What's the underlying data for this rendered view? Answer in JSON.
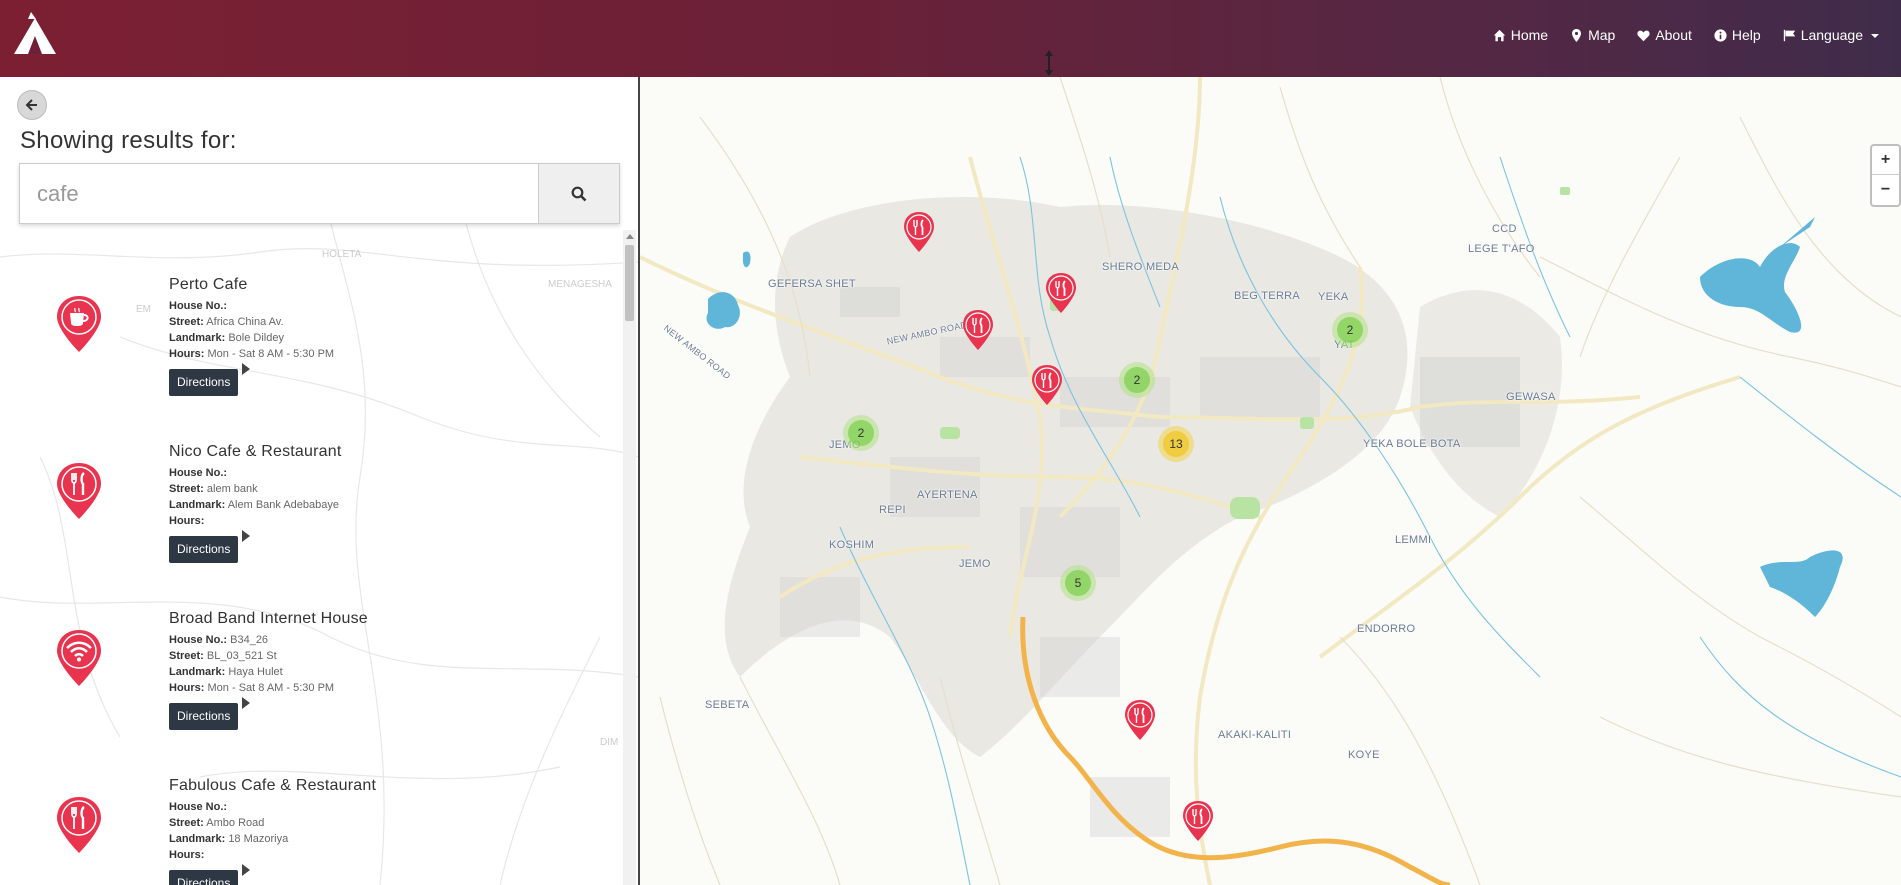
{
  "header": {
    "nav": [
      {
        "label": "Home",
        "icon": "home-icon"
      },
      {
        "label": "Map",
        "icon": "map-marker-icon"
      },
      {
        "label": "About",
        "icon": "heart-icon"
      },
      {
        "label": "Help",
        "icon": "info-circle-icon"
      },
      {
        "label": "Language",
        "icon": "flag-icon"
      }
    ]
  },
  "panel": {
    "title": "Showing results for:",
    "search": {
      "value": "cafe"
    },
    "results": [
      {
        "name": "Perto Cafe",
        "house_label": "House No.:",
        "house": "",
        "street_label": "Street:",
        "street": "Africa China Av.",
        "landmark_label": "Landmark:",
        "landmark": "Bole Dildey",
        "hours_label": "Hours:",
        "hours": "Mon - Sat 8 AM - 5:30 PM",
        "directions": "Directions",
        "icon": "coffee-cup-icon"
      },
      {
        "name": "Nico Cafe & Restaurant",
        "house_label": "House No.:",
        "house": "",
        "street_label": "Street:",
        "street": "alem bank",
        "landmark_label": "Landmark:",
        "landmark": "Alem Bank Adebabaye",
        "hours_label": "Hours:",
        "hours": "",
        "directions": "Directions",
        "icon": "fork-knife-icon"
      },
      {
        "name": "Broad Band Internet House",
        "house_label": "House No.:",
        "house": "B34_26",
        "street_label": "Street:",
        "street": "BL_03_521 St",
        "landmark_label": "Landmark:",
        "landmark": "Haya Hulet",
        "hours_label": "Hours:",
        "hours": "Mon - Sat 8 AM - 5:30 PM",
        "directions": "Directions",
        "icon": "wifi-icon"
      },
      {
        "name": "Fabulous Cafe & Restaurant",
        "house_label": "House No.:",
        "house": "",
        "street_label": "Street:",
        "street": "Ambo Road",
        "landmark_label": "Landmark:",
        "landmark": "18 Mazoriya",
        "hours_label": "Hours:",
        "hours": "",
        "directions": "Directions",
        "icon": "fork-knife-icon"
      }
    ],
    "bg_labels": [
      "HOLETA",
      "MENAGESHA",
      "EM",
      "DIM"
    ]
  },
  "map": {
    "zoom_in": "+",
    "zoom_out": "−",
    "labels": [
      "GEFERSA SHET",
      "NEW AMBO ROAD",
      "SHERO MEDA",
      "BEG TERRA",
      "YEKA",
      "CCD",
      "LEGE T'AFO",
      "GEWASA",
      "YEKA BOLE BOTA",
      "AYERTENA",
      "REPI",
      "KOSHIM",
      "JEMO",
      "LEMMI",
      "ENDORRO",
      "SEBETA",
      "AKAKI-KALITI",
      "KOYE",
      "JEMO",
      "NEW AMBO ROAD",
      "YAT"
    ],
    "clusters": [
      {
        "count": "2",
        "color": "green"
      },
      {
        "count": "2",
        "color": "green"
      },
      {
        "count": "2",
        "color": "green"
      },
      {
        "count": "13",
        "color": "yellow"
      },
      {
        "count": "5",
        "color": "green"
      }
    ],
    "water_color": "#5fb6d9",
    "marker_color": "#e8344e"
  }
}
